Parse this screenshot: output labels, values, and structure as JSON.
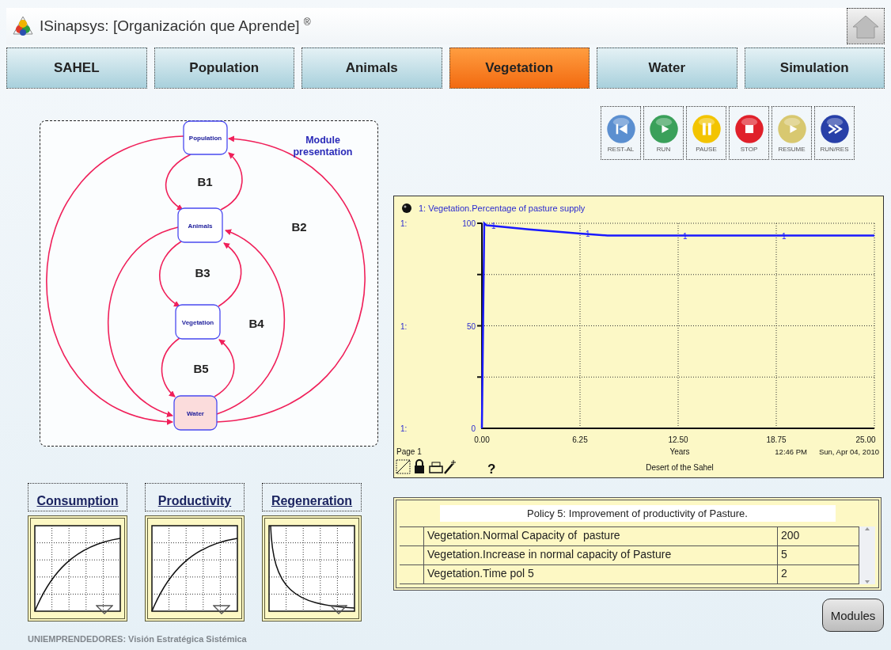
{
  "window": {
    "title": "ISinapsys: [Organización que Aprende] $^{®}$"
  },
  "tabs": [
    {
      "label": "SAHEL",
      "selected": false
    },
    {
      "label": "Population",
      "selected": false
    },
    {
      "label": "Animals",
      "selected": false
    },
    {
      "label": "Vegetation",
      "selected": true
    },
    {
      "label": "Water",
      "selected": false
    },
    {
      "label": "Simulation",
      "selected": false
    }
  ],
  "diagram": {
    "title": "Module presentation",
    "nodes": [
      {
        "label": "Population",
        "highlighted": false
      },
      {
        "label": "Animals",
        "highlighted": false
      },
      {
        "label": "Vegetation",
        "highlighted": false
      },
      {
        "label": "Water",
        "highlighted": true
      }
    ],
    "loops": [
      "B1",
      "B2",
      "B3",
      "B4",
      "B5"
    ]
  },
  "controls": [
    {
      "label": "REST-AL",
      "kind": "rewind",
      "color": "#5b8fd0"
    },
    {
      "label": "RUN",
      "kind": "play",
      "color": "#3aa05a"
    },
    {
      "label": "PAUSE",
      "kind": "pause",
      "color": "#f3c400"
    },
    {
      "label": "STOP",
      "kind": "stop",
      "color": "#e0202a"
    },
    {
      "label": "RESUME",
      "kind": "play",
      "color": "#d8c870"
    },
    {
      "label": "RUN/RES",
      "kind": "forward",
      "color": "#2840a8"
    }
  ],
  "chart": {
    "chart_data": {
      "type": "line",
      "title": "1: Vegetation.Percentage of  pasture supply",
      "xlabel": "Years",
      "x": [
        0,
        0.15,
        0.3,
        3,
        6.25,
        8,
        12.5,
        18.75,
        25
      ],
      "series": [
        {
          "name": "1",
          "color": "#1a1aff",
          "values": [
            0,
            100,
            99,
            97,
            95,
            94,
            94,
            94,
            94
          ]
        }
      ],
      "xlim": [
        0,
        25
      ],
      "ylim": [
        0,
        100
      ],
      "xticks": [
        {
          "value": 0,
          "label": "0.00"
        },
        {
          "value": 6.25,
          "label": "6.25"
        },
        {
          "value": 12.5,
          "label": "12.50"
        },
        {
          "value": 18.75,
          "label": "18.75"
        },
        {
          "value": 25,
          "label": "25.00"
        }
      ],
      "yticks": [
        0,
        50,
        100
      ],
      "grid": true
    },
    "scale_labels": [
      "1:",
      "1:",
      "1:"
    ],
    "page": "Page 1",
    "time": "12:46 PM",
    "date": "Sun, Apr 04, 2010",
    "caption": "Desert of the Sahel",
    "help": "?"
  },
  "graph_functions": [
    {
      "label": "Consumption",
      "kind": "rising"
    },
    {
      "label": "Productivity",
      "kind": "rising"
    },
    {
      "label": "Regeneration",
      "kind": "falling"
    }
  ],
  "policy": {
    "title": "Policy 5: Improvement of productivity of Pasture.",
    "rows": [
      {
        "name": "Vegetation.Normal Capacity of  pasture",
        "value": "200"
      },
      {
        "name": "Vegetation.Increase in normal capacity of Pasture",
        "value": "5"
      },
      {
        "name": "Vegetation.Time pol 5",
        "value": "2"
      }
    ]
  },
  "modules_button": "Modules",
  "footer": "UNIEMPRENDEDORES: Visión Estratégica Sistémica"
}
